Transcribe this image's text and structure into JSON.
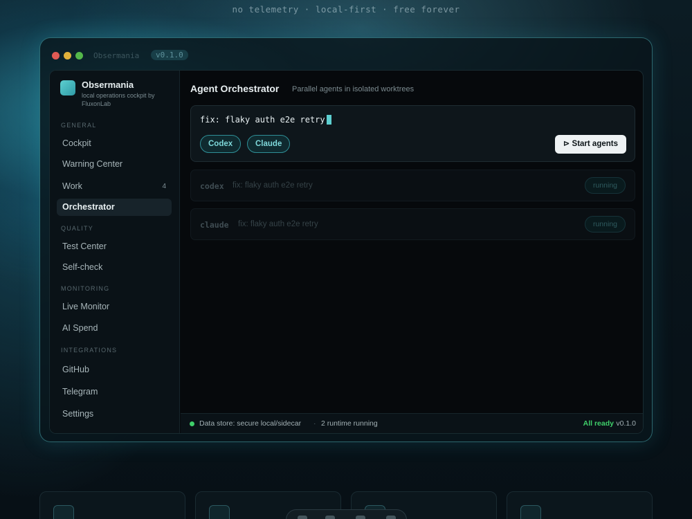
{
  "hero": {
    "tagline": "no telemetry · local-first · free forever"
  },
  "window": {
    "title": "Obsermania",
    "version": "v0.1.0"
  },
  "brand": {
    "name": "Obsermania",
    "subtitle": "local operations cockpit by FluxonLab"
  },
  "sidebar": {
    "sections": [
      {
        "label": "General",
        "items": [
          {
            "label": "Cockpit"
          },
          {
            "label": "Warning Center"
          },
          {
            "label": "Work",
            "badge": "4"
          },
          {
            "label": "Orchestrator",
            "active": true
          }
        ]
      },
      {
        "label": "Quality",
        "items": [
          {
            "label": "Test Center"
          },
          {
            "label": "Self-check"
          }
        ]
      },
      {
        "label": "Monitoring",
        "items": [
          {
            "label": "Live Monitor"
          },
          {
            "label": "AI Spend"
          }
        ]
      },
      {
        "label": "Integrations",
        "items": [
          {
            "label": "GitHub"
          },
          {
            "label": "Telegram"
          },
          {
            "label": "Settings"
          }
        ]
      }
    ]
  },
  "main": {
    "title": "Agent Orchestrator",
    "subtitle": "Parallel agents in isolated worktrees",
    "composer": {
      "prompt": "fix: flaky auth e2e retry",
      "chips": [
        "Codex",
        "Claude"
      ],
      "start_label": "⊳ Start agents"
    },
    "agents": [
      {
        "name": "codex",
        "task": "fix: flaky auth e2e retry",
        "status": "running"
      },
      {
        "name": "claude",
        "task": "fix: flaky auth e2e retry",
        "status": "running"
      }
    ]
  },
  "statusbar": {
    "store": "Data store: secure local/sidecar",
    "separator": "·",
    "runtime": "2 runtime running",
    "ready": "All ready",
    "version": "v0.1.0"
  },
  "colors": {
    "accent": "#5dcfd0",
    "ready_green": "#3fcf6a",
    "traffic_red": "#e05a54",
    "traffic_yellow": "#e1b23b",
    "traffic_green": "#54b74a"
  }
}
